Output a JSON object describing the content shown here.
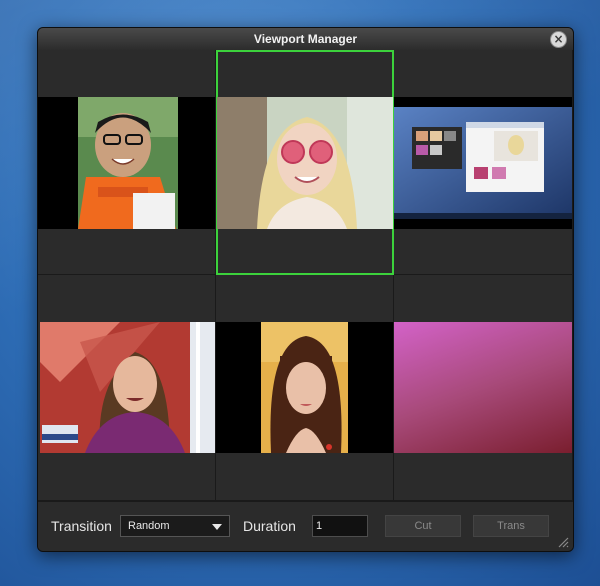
{
  "window": {
    "title": "Viewport Manager",
    "close_icon": "close-icon",
    "selected_cell": 1
  },
  "viewports": [
    {
      "content": "boy-with-glasses-in-orange-life-vest"
    },
    {
      "content": "blonde-woman-with-heart-sunglasses"
    },
    {
      "content": "desktop-screenshot-of-app"
    },
    {
      "content": "news-anchor-woman-in-purple"
    },
    {
      "content": "woman-with-bangs-on-yellow-background"
    },
    {
      "content": "pink-gradient-background"
    }
  ],
  "controls": {
    "transition_label": "Transition",
    "transition_value": "Random",
    "duration_label": "Duration",
    "duration_value": "1",
    "cut_label": "Cut",
    "trans_label": "Trans"
  },
  "colors": {
    "selection": "#3cd23c",
    "window_bg": "#262626"
  }
}
